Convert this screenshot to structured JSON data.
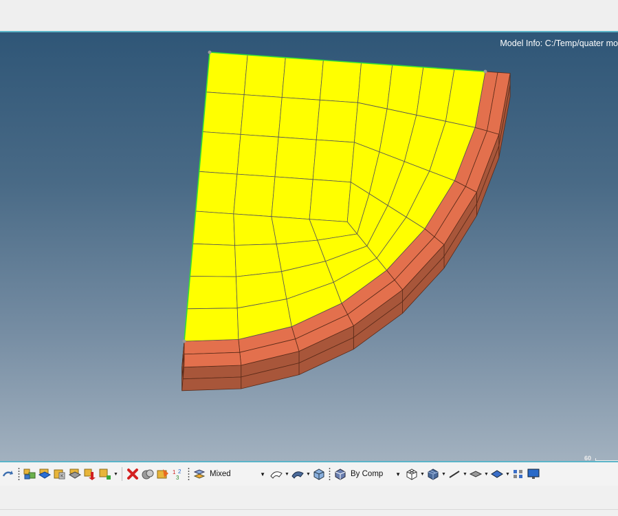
{
  "viewport": {
    "model_info": "Model Info: C:/Temp/quater mo",
    "scale_label": "60"
  },
  "toolbar": {
    "display_mode_value": "Mixed",
    "color_mode_value": "By Comp",
    "icons": [
      "rotate-arrow-icon",
      "components-icon",
      "component-blue-icon",
      "assembly-icon",
      "component-gray-icon",
      "show-elements-icon",
      "hide-elements-icon",
      "delete-icon",
      "mask-icon",
      "unmask-icon",
      "numbering-icon",
      "shading-mode-icon",
      "geometry-surface-icon",
      "geometry-solid-icon",
      "element-solid-icon",
      "color-by-comp-icon",
      "mesh-wireframe-icon",
      "mesh-shaded-icon",
      "line-icon",
      "plane-icon",
      "feature-icon",
      "scale-icon",
      "monitor-icon"
    ]
  },
  "colors": {
    "mesh_face": "#ffff00",
    "solid_top": "#e3704d",
    "solid_side": "#a8563a",
    "mesh_line": "#555555",
    "highlight_edge": "#33dd33",
    "viewport_top": "#2f5677",
    "viewport_bottom": "#a2b1bf"
  }
}
